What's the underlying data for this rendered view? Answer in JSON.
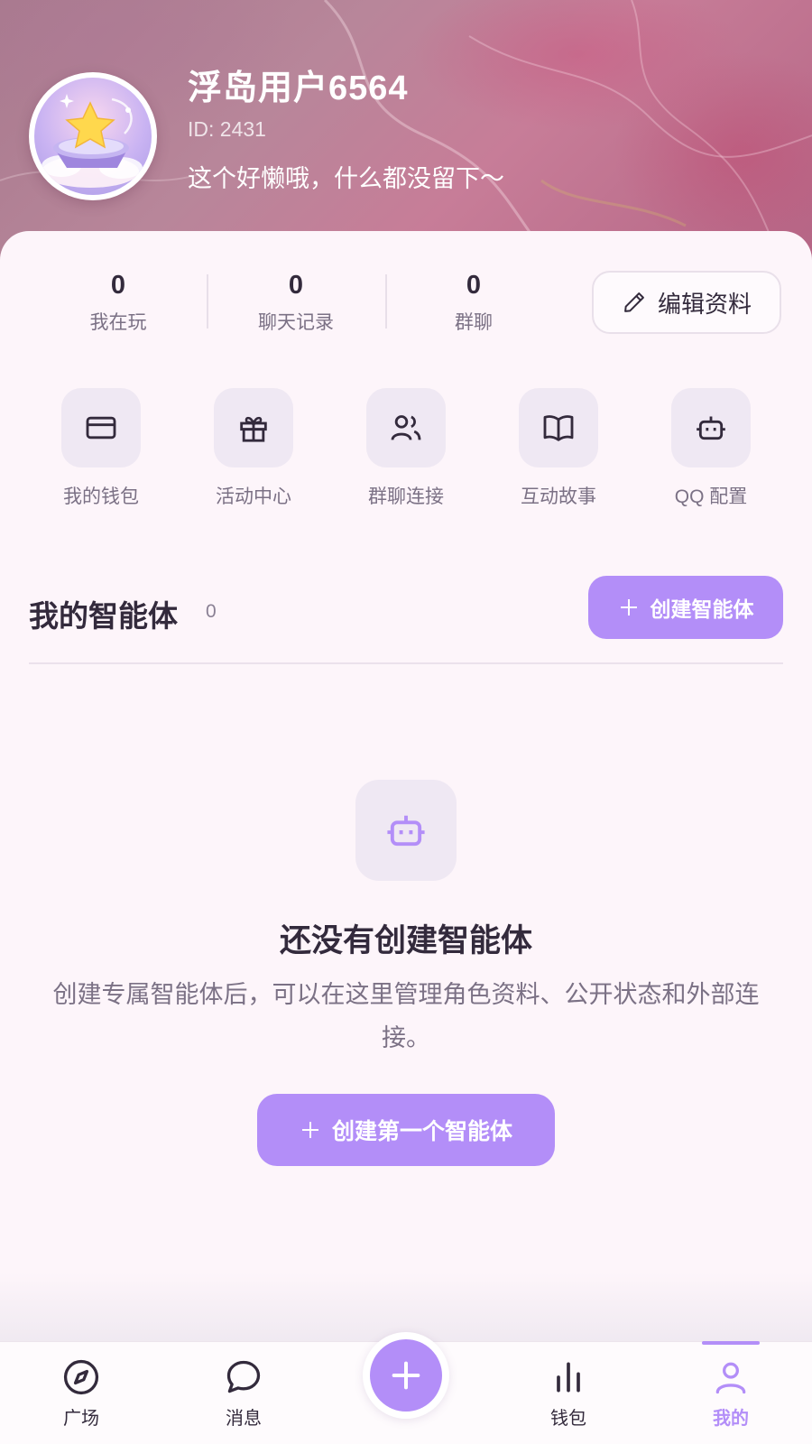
{
  "profile": {
    "name": "浮岛用户6564",
    "id": "ID: 2431",
    "bio": "这个好懒哦，什么都没留下～"
  },
  "stats": [
    {
      "value": "0",
      "label": "我在玩"
    },
    {
      "value": "0",
      "label": "聊天记录"
    },
    {
      "value": "0",
      "label": "群聊"
    }
  ],
  "edit_profile_label": "编辑资料",
  "quick_actions": [
    {
      "label": "我的钱包",
      "icon": "wallet-icon"
    },
    {
      "label": "活动中心",
      "icon": "gift-icon"
    },
    {
      "label": "群聊连接",
      "icon": "users-icon"
    },
    {
      "label": "互动故事",
      "icon": "book-icon"
    },
    {
      "label": "QQ 配置",
      "icon": "bot-icon"
    }
  ],
  "agents_section": {
    "title": "我的智能体",
    "count": "0",
    "create_label": "创建智能体"
  },
  "empty_state": {
    "icon": "bot-icon",
    "title": "还没有创建智能体",
    "description": "创建专属智能体后，可以在这里管理角色资料、公开状态和外部连接。",
    "button_label": "创建第一个智能体"
  },
  "bottom_nav": {
    "items": [
      {
        "label": "广场",
        "icon": "compass-icon"
      },
      {
        "label": "消息",
        "icon": "chat-icon"
      },
      {
        "label": "钱包",
        "icon": "bar-chart-icon"
      },
      {
        "label": "我的",
        "icon": "user-icon"
      }
    ],
    "active": "我的",
    "fab_icon": "plus-icon"
  },
  "colors": {
    "accent": "#b38ef8",
    "text_primary": "#332a3c",
    "text_secondary": "#7b7185",
    "tile_bg": "#efe8f3",
    "page_bg": "#fdf5fa"
  }
}
